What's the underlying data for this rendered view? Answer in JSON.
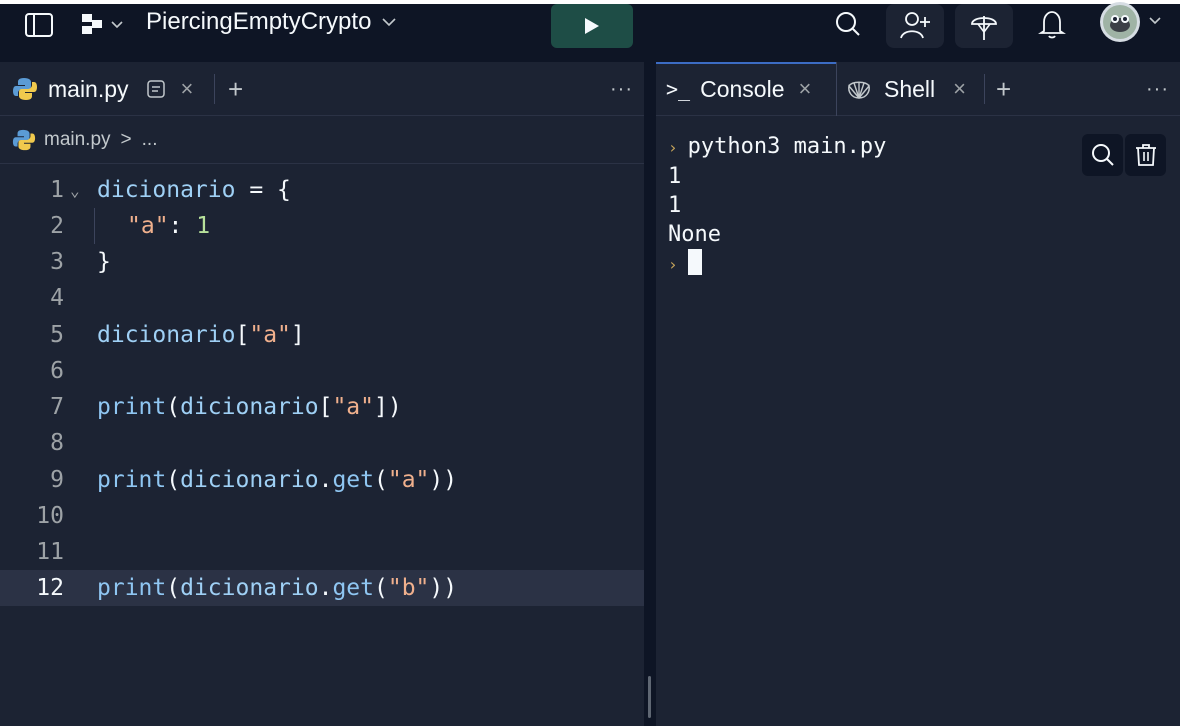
{
  "topbar": {
    "project_name": "PiercingEmptyCrypto"
  },
  "editor": {
    "tab": {
      "label": "main.py",
      "close": "×",
      "add": "+",
      "more": "···"
    },
    "breadcrumb": {
      "file": "main.py",
      "separator": ">",
      "rest": "..."
    },
    "lines": [
      {
        "n": "1"
      },
      {
        "n": "2"
      },
      {
        "n": "3"
      },
      {
        "n": "4"
      },
      {
        "n": "5"
      },
      {
        "n": "6"
      },
      {
        "n": "7"
      },
      {
        "n": "8"
      },
      {
        "n": "9"
      },
      {
        "n": "10"
      },
      {
        "n": "11"
      },
      {
        "n": "12"
      }
    ],
    "code": {
      "l1_var": "dicionario",
      "l1_op": " = {",
      "l2_key": "\"a\"",
      "l2_colon": ": ",
      "l2_val": "1",
      "l3": "}",
      "l5_var": "dicionario",
      "l5_open": "[",
      "l5_str": "\"a\"",
      "l5_close": "]",
      "l7_fn": "print",
      "l7_open": "(",
      "l7_var": "dicionario",
      "l7_b1": "[",
      "l7_str": "\"a\"",
      "l7_close": "])",
      "l9_fn": "print",
      "l9_open": "(",
      "l9_var": "dicionario",
      "l9_dot": ".",
      "l9_get": "get",
      "l9_p": "(",
      "l9_str": "\"a\"",
      "l9_close": "))",
      "l12_fn": "print",
      "l12_open": "(",
      "l12_var": "dicionario",
      "l12_dot": ".",
      "l12_get": "get",
      "l12_p": "(",
      "l12_str": "\"b\"",
      "l12_close": "))"
    },
    "active_line": 12
  },
  "console": {
    "tabs": [
      {
        "label": "Console",
        "icon": ">_",
        "close": "×"
      },
      {
        "label": "Shell",
        "close": "×"
      }
    ],
    "add": "+",
    "more": "···",
    "command": "python3 main.py",
    "output": [
      "1",
      "1",
      "None"
    ]
  },
  "colors": {
    "accent": "#3c6cc4",
    "run_button": "#1e4d46",
    "background": "#1c2333",
    "topbar": "#0e1525"
  }
}
